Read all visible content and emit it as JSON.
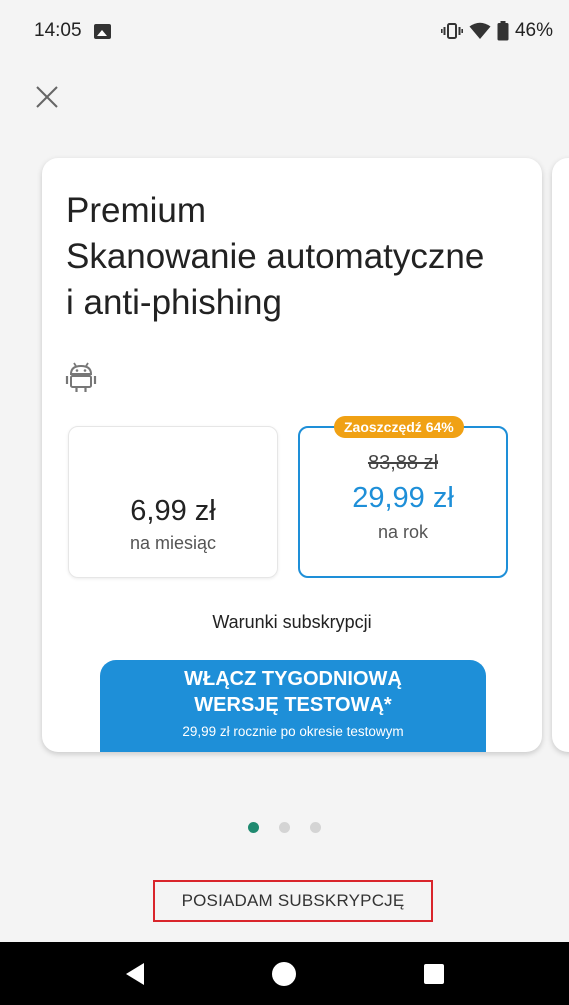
{
  "status_bar": {
    "time": "14:05",
    "battery": "46%",
    "icons": [
      "image-notification-icon",
      "vibrate-icon",
      "wifi-icon",
      "battery-icon"
    ]
  },
  "close": {
    "icon": "close-icon"
  },
  "card": {
    "title_lines": [
      "Premium",
      "Skanowanie automatyczne",
      "i anti-phishing"
    ],
    "platform_icon": "android-icon",
    "plans": {
      "monthly": {
        "price": "6,99 zł",
        "period": "na miesiąc"
      },
      "yearly": {
        "badge": "Zaoszczędź 64%",
        "old_price": "83,88 zł",
        "price": "29,99 zł",
        "period": "na rok",
        "selected": true
      }
    },
    "terms_label": "Warunki subskrypcji",
    "trial_button": {
      "label": "WŁĄCZ TYGODNIOWĄ WERSJĘ TESTOWĄ*",
      "sub": "29,99 zł rocznie po okresie testowym"
    }
  },
  "pager": {
    "count": 3,
    "active_index": 0
  },
  "have_subscription_label": "POSIADAM SUBSKRYPCJĘ",
  "colors": {
    "accent_blue": "#1e8fd8",
    "badge_orange": "#f0a114",
    "pager_active": "#1f8a70",
    "highlight_red": "#d9252b"
  },
  "nav_bar": {
    "icons": [
      "back-icon",
      "home-icon",
      "recents-icon"
    ]
  }
}
